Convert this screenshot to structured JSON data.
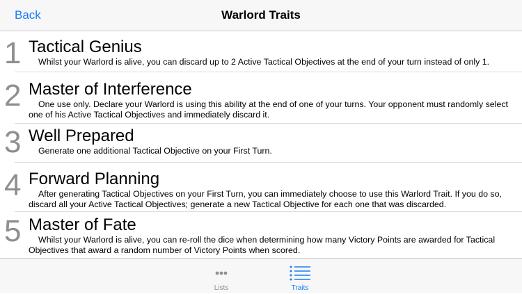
{
  "navbar": {
    "back_label": "Back",
    "title": "Warlord Traits"
  },
  "traits": [
    {
      "number": "1",
      "name": "Tactical Genius",
      "description": "Whilst your Warlord is alive, you can discard up to 2 Active Tactical Objectives at the end of your turn instead of only 1."
    },
    {
      "number": "2",
      "name": "Master of Interference",
      "description": "One use only. Declare your Warlord is using this ability at the end of one of your turns. Your opponent must randomly select one of his Active Tactical Objectives and immediately discard it."
    },
    {
      "number": "3",
      "name": "Well Prepared",
      "description": "Generate one additional Tactical Objective on your First Turn."
    },
    {
      "number": "4",
      "name": "Forward Planning",
      "description": "After generating Tactical Objectives on your First Turn, you can immediately choose to use this Warlord Trait. If you do so, discard all your Active Tactical Objectives; generate a new Tactical Objective for each one that was discarded."
    },
    {
      "number": "5",
      "name": "Master of Fate",
      "description": "Whilst your Warlord is alive, you can re-roll the dice when determining how many Victory Points are awarded for Tactical Objectives that award a random number of Victory Points when scored."
    }
  ],
  "tabbar": {
    "tabs": [
      {
        "label": "Lists",
        "icon": "ellipsis-icon",
        "selected": false,
        "color": "#8e8e93"
      },
      {
        "label": "Traits",
        "icon": "list-icon",
        "selected": true,
        "color": "#1a7cf5"
      }
    ]
  },
  "colors": {
    "accent": "#1a7cf5",
    "inactive": "#8e8e93",
    "bar_background": "#f7f7f8"
  }
}
